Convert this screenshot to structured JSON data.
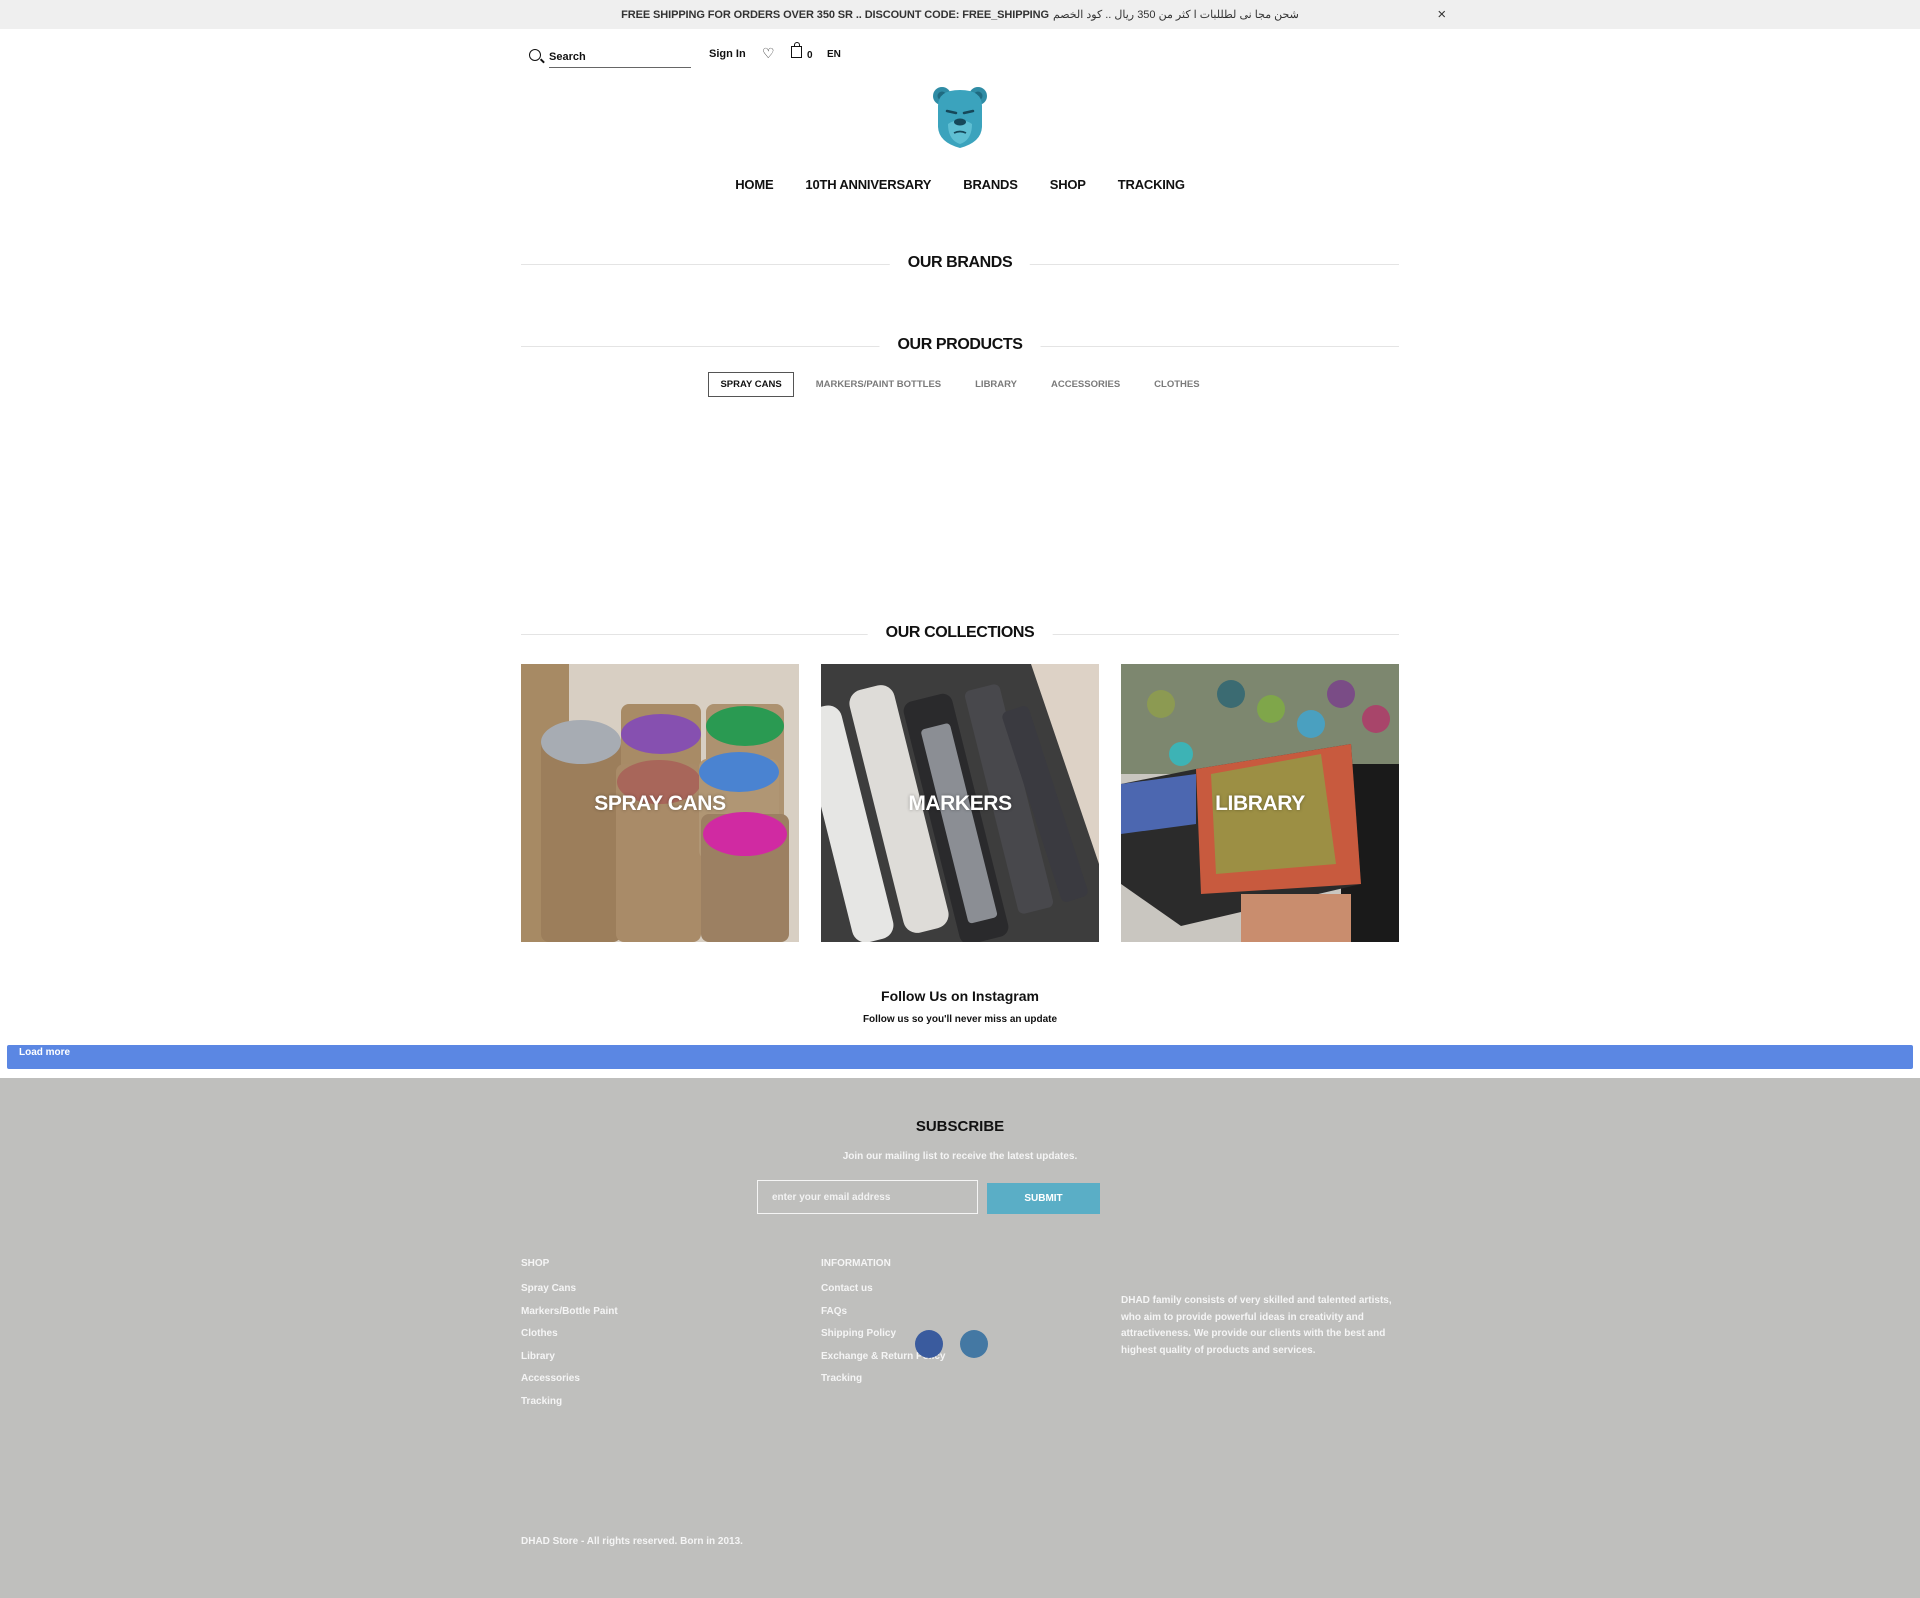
{
  "announcement": {
    "text_en": "FREE SHIPPING FOR ORDERS OVER 350 SR .. DISCOUNT CODE: FREE_SHIPPING",
    "text_ar": "شحن مجا نى لطللبات ا كثر من 350 ريال .. كود الخصم",
    "close_icon": "×"
  },
  "header": {
    "search_placeholder": "Search",
    "sign_in": "Sign In",
    "wishlist_icon": "♡",
    "cart_count": "0",
    "language": "EN"
  },
  "nav": {
    "items": [
      "HOME",
      "10TH ANNIVERSARY",
      "BRANDS",
      "SHOP",
      "TRACKING"
    ]
  },
  "sections": {
    "brands_title": "OUR BRANDS",
    "products_title": "OUR PRODUCTS",
    "collections_title": "OUR COLLECTIONS"
  },
  "product_tabs": {
    "items": [
      "SPRAY CANS",
      "MARKERS/PAINT BOTTLES",
      "LIBRARY",
      "ACCESSORIES",
      "CLOTHES"
    ],
    "active": "SPRAY CANS"
  },
  "collections": [
    {
      "label": "SPRAY CANS"
    },
    {
      "label": "MARKERS"
    },
    {
      "label": "LIBRARY"
    }
  ],
  "instagram": {
    "title": "Follow Us on Instagram",
    "subtitle": "Follow us so you'll never miss an update",
    "load_more": "Load more"
  },
  "footer": {
    "subscribe_title": "SUBSCRIBE",
    "subscribe_text": "Join our mailing list to receive the latest updates.",
    "email_placeholder": "enter your email address",
    "submit": "SUBMIT",
    "shop": {
      "title": "SHOP",
      "links": [
        "Spray Cans",
        "Markers/Bottle Paint",
        "Clothes",
        "Library",
        "Accessories",
        "Tracking"
      ]
    },
    "information": {
      "title": "INFORMATION",
      "links": [
        "Contact us",
        "FAQs",
        "Shipping Policy",
        "Exchange & Return Policy",
        "Tracking"
      ]
    },
    "about": "DHAD family consists of very skilled and talented artists, who aim to provide powerful ideas in creativity and attractiveness. We provide our clients with the best and highest quality of products and services.",
    "social": [
      "facebook",
      "twitter"
    ],
    "copyright": "DHAD Store - All rights reserved. Born in 2013."
  },
  "colors": {
    "load_more_bg": "#5b87e3",
    "submit_bg": "#5aaec6",
    "footer_bg": "#bfbfbd",
    "facebook": "#3a5b9e",
    "twitter": "#4478a3"
  }
}
